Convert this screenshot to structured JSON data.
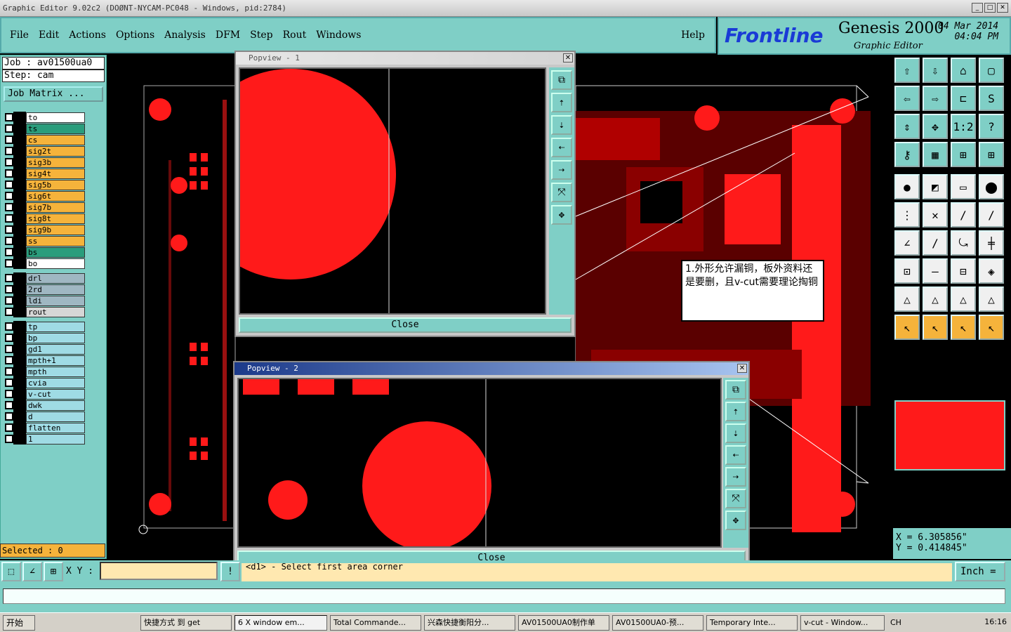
{
  "window": {
    "title": "Graphic Editor 9.02c2 (DOØNT-NYCAM-PC048 - Windows, pid:2784)",
    "min": "_",
    "max": "□",
    "close": "✕"
  },
  "menu": {
    "items": [
      "File",
      "Edit",
      "Actions",
      "Options",
      "Analysis",
      "DFM",
      "Step",
      "Rout",
      "Windows"
    ],
    "help": "Help"
  },
  "logo": {
    "brand": "Frontline",
    "product": "Genesis 2000",
    "subtitle": "Graphic Editor",
    "date": "04 Mar 2014",
    "time": "04:04 PM"
  },
  "job": {
    "job_line": "Job : av01500ua0",
    "step_line": "Step: cam",
    "matrix_button": "Job Matrix ..."
  },
  "layers": [
    {
      "name": "to",
      "color": "#ffffff"
    },
    {
      "name": "ts",
      "color": "#2a9d7c"
    },
    {
      "name": "cs",
      "color": "#f5b33b"
    },
    {
      "name": "sig2t",
      "color": "#f5b33b"
    },
    {
      "name": "sig3b",
      "color": "#f5b33b"
    },
    {
      "name": "sig4t",
      "color": "#f5b33b"
    },
    {
      "name": "sig5b",
      "color": "#f5b33b"
    },
    {
      "name": "sig6t",
      "color": "#f5b33b"
    },
    {
      "name": "sig7b",
      "color": "#f5b33b"
    },
    {
      "name": "sig8t",
      "color": "#f5b33b"
    },
    {
      "name": "sig9b",
      "color": "#f5b33b"
    },
    {
      "name": "ss",
      "color": "#f5b33b"
    },
    {
      "name": "bs",
      "color": "#2a9d7c"
    },
    {
      "name": "bo",
      "color": "#ffffff"
    },
    {
      "name": "drl",
      "color": "#9fb7c2"
    },
    {
      "name": "2rd",
      "color": "#9fb7c2"
    },
    {
      "name": "ldi",
      "color": "#9fb7c2"
    },
    {
      "name": "rout",
      "color": "#d6d6d6"
    },
    {
      "name": "tp",
      "color": "#9fdbe4"
    },
    {
      "name": "bp",
      "color": "#9fdbe4"
    },
    {
      "name": "gd1",
      "color": "#9fdbe4"
    },
    {
      "name": "mpth+1",
      "color": "#9fdbe4"
    },
    {
      "name": "mpth",
      "color": "#9fdbe4"
    },
    {
      "name": "cvia",
      "color": "#9fdbe4"
    },
    {
      "name": "v-cut",
      "color": "#9fdbe4"
    },
    {
      "name": "dwk",
      "color": "#9fdbe4"
    },
    {
      "name": "d",
      "color": "#9fdbe4"
    },
    {
      "name": "flatten",
      "color": "#9fdbe4"
    },
    {
      "name": "1",
      "color": "#9fdbe4"
    }
  ],
  "selected": "Selected : 0",
  "popview1": {
    "title": "Popview - 1",
    "close": "Close"
  },
  "popview2": {
    "title": "Popview - 2",
    "close": "Close"
  },
  "note": {
    "text": "1.外形允许漏铜，板外资料还是要删，且v-cut需要理论掏铜"
  },
  "coords": {
    "x": "X = 6.305856\"",
    "y": "Y = 0.414845\""
  },
  "command": {
    "xy_label": "X Y :",
    "message": "<d1> - Select first area corner",
    "unit": "Inch ="
  },
  "taskbar": {
    "start": "开始",
    "items": [
      "快捷方式 到 get",
      "6 X window em...",
      "Total Commande...",
      "兴森快捷衡阳分...",
      "AV01500UA0制作单",
      "AV01500UA0-预...",
      "Temporary Inte...",
      "v-cut - Window..."
    ],
    "tray": "CH",
    "clock": "16:16"
  },
  "colors": {
    "copper": "#ff1a1a",
    "panel": "#7fcfc6",
    "accent": "#f5b33b"
  }
}
